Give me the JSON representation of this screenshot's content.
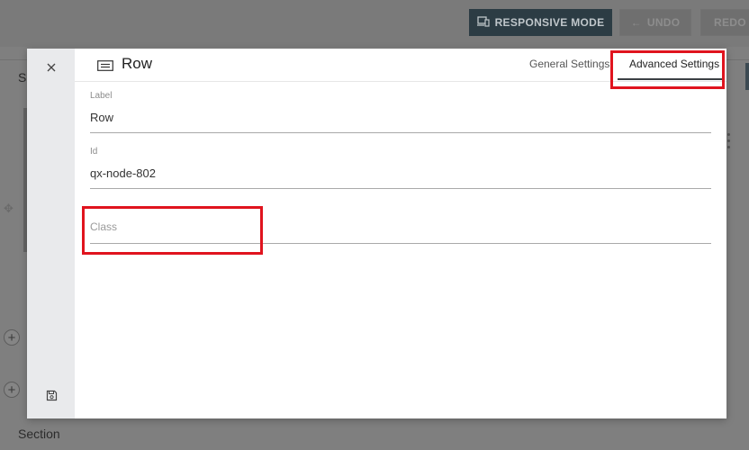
{
  "background": {
    "toolbar": {
      "responsive_mode_label": "RESPONSIVE MODE",
      "undo_label": "UNDO",
      "redo_label": "REDO"
    },
    "s_label": "S",
    "section_label": "Section"
  },
  "modal": {
    "title": "Row",
    "tabs": [
      {
        "label": "General Settings",
        "active": false
      },
      {
        "label": "Advanced Settings",
        "active": true
      }
    ],
    "fields": {
      "label": {
        "label": "Label",
        "value": "Row"
      },
      "id": {
        "label": "Id",
        "value": "qx-node-802"
      },
      "class": {
        "placeholder": "Class",
        "value": ""
      }
    }
  },
  "colors": {
    "highlight": "#e0141e",
    "tab_underline": "#3b4044",
    "rail": "#e9eaec"
  }
}
